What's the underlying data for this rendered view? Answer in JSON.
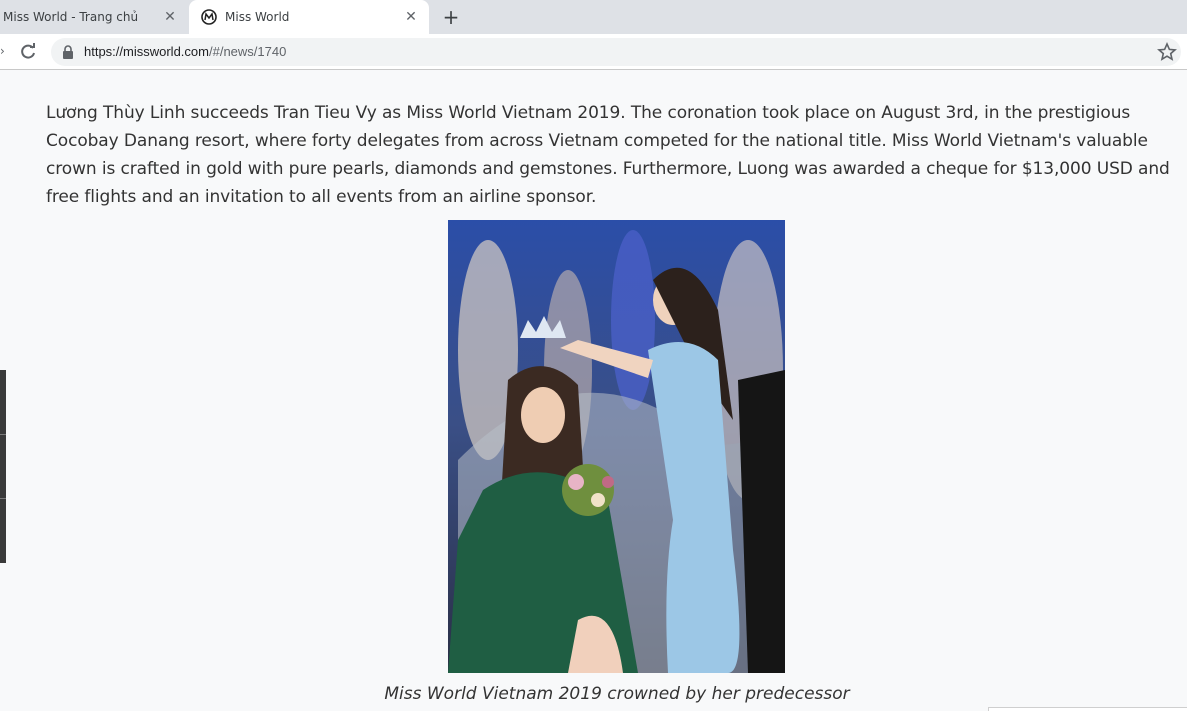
{
  "browser": {
    "tabs": [
      {
        "title": "Miss World - Trang chủ",
        "active": false
      },
      {
        "title": "Miss World",
        "active": true
      }
    ],
    "url_host": "https://missworld.com",
    "url_path": "/#/news/1740"
  },
  "article": {
    "paragraph": "Lương Thùy Linh succeeds Tran Tieu Vy as Miss World Vietnam 2019. The coronation took place on August 3rd, in the prestigious Cocobay Danang resort, where forty delegates from across Vietnam competed for the national title. Miss World Vietnam's valuable crown is crafted in gold with pure pearls, diamonds and gemstones. Furthermore, Luong was awarded a cheque for $13,000 USD and free flights and an invitation to all events from an airline sponsor.",
    "image_caption": "Miss World Vietnam 2019 crowned by her predecessor"
  },
  "colors": {
    "stage_blue": "#1b2a55",
    "gown_green": "#1f5e43",
    "gown_lightblue": "#9cc7e6"
  }
}
